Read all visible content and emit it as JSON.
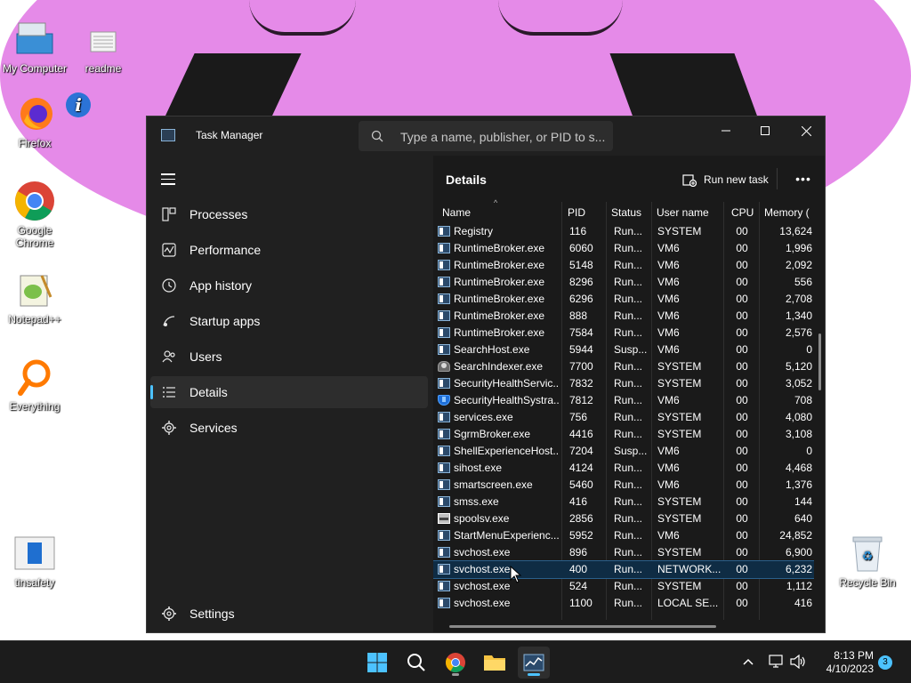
{
  "desktop": {
    "icons": [
      {
        "label": "My Computer",
        "icon": "computer-icon"
      },
      {
        "label": "readme",
        "icon": "text-file-icon"
      },
      {
        "label": "Firefox",
        "icon": "firefox-icon"
      },
      {
        "label": "",
        "icon": "info-icon"
      },
      {
        "label": "Google Chrome",
        "icon": "chrome-icon"
      },
      {
        "label": "Notepad++",
        "icon": "notepadpp-icon"
      },
      {
        "label": "Everything",
        "icon": "everything-search-icon"
      },
      {
        "label": "tinsafety",
        "icon": "document-icon"
      },
      {
        "label": "Recycle Bin",
        "icon": "recycle-bin-icon"
      }
    ]
  },
  "window": {
    "title": "Task Manager",
    "search_placeholder": "Type a name, publisher, or PID to s..."
  },
  "nav": {
    "items": [
      {
        "label": "Processes",
        "icon": "processes-icon",
        "active": false
      },
      {
        "label": "Performance",
        "icon": "performance-icon",
        "active": false
      },
      {
        "label": "App history",
        "icon": "app-history-icon",
        "active": false
      },
      {
        "label": "Startup apps",
        "icon": "startup-apps-icon",
        "active": false
      },
      {
        "label": "Users",
        "icon": "users-icon",
        "active": false
      },
      {
        "label": "Details",
        "icon": "details-icon",
        "active": true
      },
      {
        "label": "Services",
        "icon": "services-icon",
        "active": false
      }
    ],
    "settings_label": "Settings"
  },
  "details": {
    "title": "Details",
    "run_new_task_label": "Run new task",
    "more_label": "•••",
    "sort_indicator": "^",
    "columns": [
      "Name",
      "PID",
      "Status",
      "User name",
      "CPU",
      "Memory ("
    ],
    "rows": [
      {
        "name": "Registry",
        "pid": "116",
        "status": "Run...",
        "user": "SYSTEM",
        "cpu": "00",
        "mem": "13,624",
        "icon": "app-icon"
      },
      {
        "name": "RuntimeBroker.exe",
        "pid": "6060",
        "status": "Run...",
        "user": "VM6",
        "cpu": "00",
        "mem": "1,996",
        "icon": "app-icon"
      },
      {
        "name": "RuntimeBroker.exe",
        "pid": "5148",
        "status": "Run...",
        "user": "VM6",
        "cpu": "00",
        "mem": "2,092",
        "icon": "app-icon"
      },
      {
        "name": "RuntimeBroker.exe",
        "pid": "8296",
        "status": "Run...",
        "user": "VM6",
        "cpu": "00",
        "mem": "556",
        "icon": "app-icon"
      },
      {
        "name": "RuntimeBroker.exe",
        "pid": "6296",
        "status": "Run...",
        "user": "VM6",
        "cpu": "00",
        "mem": "2,708",
        "icon": "app-icon"
      },
      {
        "name": "RuntimeBroker.exe",
        "pid": "888",
        "status": "Run...",
        "user": "VM6",
        "cpu": "00",
        "mem": "1,340",
        "icon": "app-icon"
      },
      {
        "name": "RuntimeBroker.exe",
        "pid": "7584",
        "status": "Run...",
        "user": "VM6",
        "cpu": "00",
        "mem": "2,576",
        "icon": "app-icon"
      },
      {
        "name": "SearchHost.exe",
        "pid": "5944",
        "status": "Susp...",
        "user": "VM6",
        "cpu": "00",
        "mem": "0",
        "icon": "app-icon"
      },
      {
        "name": "SearchIndexer.exe",
        "pid": "7700",
        "status": "Run...",
        "user": "SYSTEM",
        "cpu": "00",
        "mem": "5,120",
        "icon": "user-icon"
      },
      {
        "name": "SecurityHealthServic...",
        "pid": "7832",
        "status": "Run...",
        "user": "SYSTEM",
        "cpu": "00",
        "mem": "3,052",
        "icon": "app-icon"
      },
      {
        "name": "SecurityHealthSystra...",
        "pid": "7812",
        "status": "Run...",
        "user": "VM6",
        "cpu": "00",
        "mem": "708",
        "icon": "shield-icon"
      },
      {
        "name": "services.exe",
        "pid": "756",
        "status": "Run...",
        "user": "SYSTEM",
        "cpu": "00",
        "mem": "4,080",
        "icon": "app-icon"
      },
      {
        "name": "SgrmBroker.exe",
        "pid": "4416",
        "status": "Run...",
        "user": "SYSTEM",
        "cpu": "00",
        "mem": "3,108",
        "icon": "app-icon"
      },
      {
        "name": "ShellExperienceHost....",
        "pid": "7204",
        "status": "Susp...",
        "user": "VM6",
        "cpu": "00",
        "mem": "0",
        "icon": "app-icon"
      },
      {
        "name": "sihost.exe",
        "pid": "4124",
        "status": "Run...",
        "user": "VM6",
        "cpu": "00",
        "mem": "4,468",
        "icon": "app-icon"
      },
      {
        "name": "smartscreen.exe",
        "pid": "5460",
        "status": "Run...",
        "user": "VM6",
        "cpu": "00",
        "mem": "1,376",
        "icon": "app-icon"
      },
      {
        "name": "smss.exe",
        "pid": "416",
        "status": "Run...",
        "user": "SYSTEM",
        "cpu": "00",
        "mem": "144",
        "icon": "app-icon"
      },
      {
        "name": "spoolsv.exe",
        "pid": "2856",
        "status": "Run...",
        "user": "SYSTEM",
        "cpu": "00",
        "mem": "640",
        "icon": "printer-icon"
      },
      {
        "name": "StartMenuExperienc...",
        "pid": "5952",
        "status": "Run...",
        "user": "VM6",
        "cpu": "00",
        "mem": "24,852",
        "icon": "app-icon"
      },
      {
        "name": "svchost.exe",
        "pid": "896",
        "status": "Run...",
        "user": "SYSTEM",
        "cpu": "00",
        "mem": "6,900",
        "icon": "app-icon"
      },
      {
        "name": "svchost.exe",
        "pid": "400",
        "status": "Run...",
        "user": "NETWORK...",
        "cpu": "00",
        "mem": "6,232",
        "icon": "app-icon",
        "selected": true
      },
      {
        "name": "svchost.exe",
        "pid": "524",
        "status": "Run...",
        "user": "SYSTEM",
        "cpu": "00",
        "mem": "1,112",
        "icon": "app-icon"
      },
      {
        "name": "svchost.exe",
        "pid": "1100",
        "status": "Run...",
        "user": "LOCAL SE...",
        "cpu": "00",
        "mem": "416",
        "icon": "app-icon"
      }
    ]
  },
  "taskbar": {
    "apps": [
      {
        "name": "start",
        "icon": "windows-start-icon"
      },
      {
        "name": "search",
        "icon": "search-icon"
      },
      {
        "name": "chrome",
        "icon": "chrome-icon"
      },
      {
        "name": "file-explorer",
        "icon": "folder-icon"
      },
      {
        "name": "task-manager",
        "icon": "task-manager-icon",
        "active": true
      }
    ],
    "time": "8:13 PM",
    "date": "4/10/2023",
    "notification_count": "3"
  },
  "colors": {
    "accent": "#4cc2ff",
    "window_bg": "#202020",
    "content_bg": "#1a1a1a",
    "selected_row": "#0f2c44",
    "wallpaper_pink": "#e58ae8"
  }
}
